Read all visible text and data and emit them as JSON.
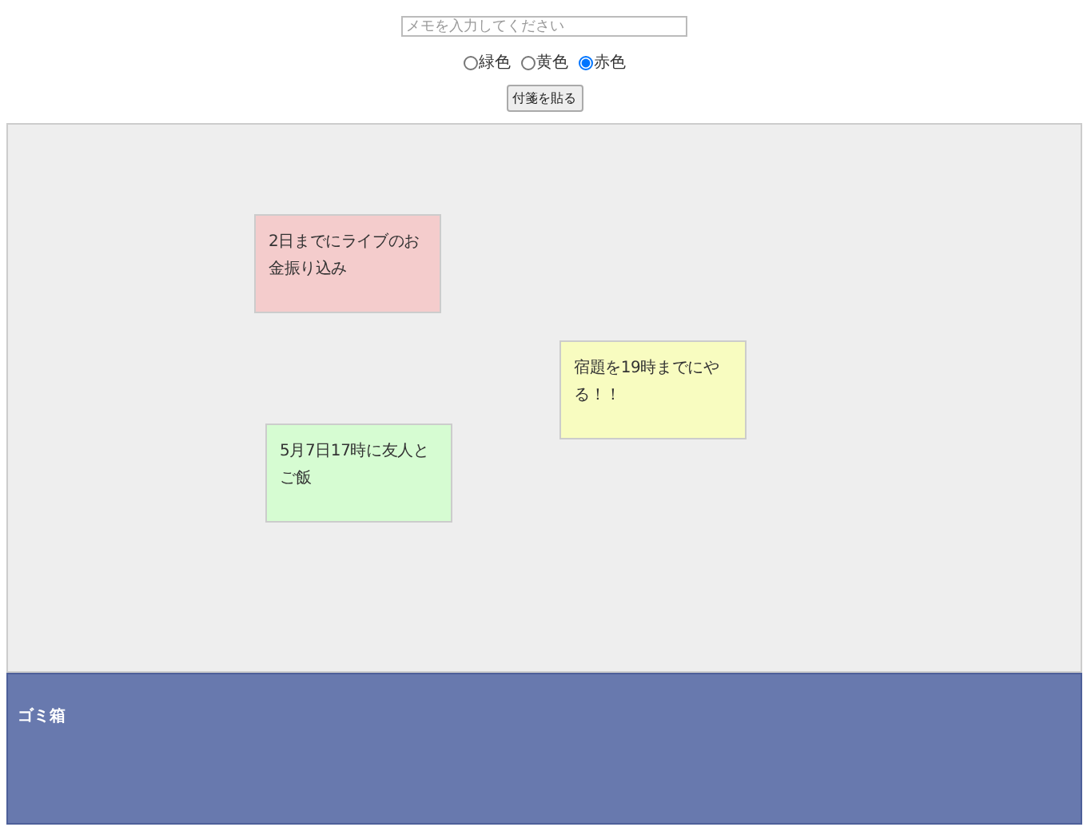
{
  "memo_field": {
    "placeholder": "メモを入力してください"
  },
  "color_options": [
    {
      "label": "緑色",
      "selected": false
    },
    {
      "label": "黄色",
      "selected": false
    },
    {
      "label": "赤色",
      "selected": true
    }
  ],
  "post_button": "付箋を貼る",
  "notes": [
    {
      "text": "2日までにライブのお金振り込み",
      "color": "#f4cccc"
    },
    {
      "text": "宿題を19時までにやる！！",
      "color": "#f8fcc0"
    },
    {
      "text": "5月7日17時に友人とご飯",
      "color": "#d6fcd2"
    }
  ],
  "trash": {
    "label": "ゴミ箱"
  }
}
